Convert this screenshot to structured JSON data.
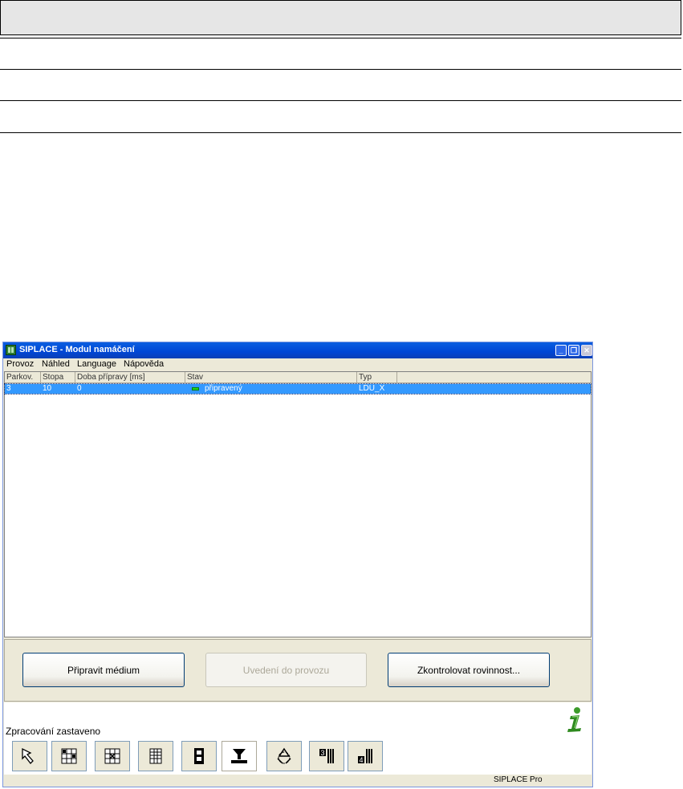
{
  "window": {
    "title": "SIPLACE - Modul namáčení",
    "min_glyph": "_",
    "max_glyph": "❐",
    "close_glyph": "✕"
  },
  "menu": [
    "Provoz",
    "Náhled",
    "Language",
    "Nápověda"
  ],
  "table": {
    "columns": [
      "Parkov.",
      "Stopa",
      "Doba přípravy [ms]",
      "Stav",
      "Typ"
    ],
    "rows": [
      {
        "parkov": "3",
        "stopa": "10",
        "doba": "0",
        "stav": "připravený",
        "typ": "LDU_X"
      }
    ]
  },
  "actions": {
    "prepare": "Připravit médium",
    "commission": "Uvedení do provozu",
    "check": "Zkontrolovat rovinnost..."
  },
  "status": {
    "text": "Zpracování zastaveno"
  },
  "toolbar": {
    "icons": [
      "arrow-cursor-icon",
      "grid-icon",
      "grid-cross-icon",
      "table-icon",
      "film-icon",
      "dip-unit-icon",
      "recycle-icon",
      "feeder-3-icon",
      "feeder-4-icon"
    ],
    "active_index": 5
  },
  "footer": {
    "product": "SIPLACE Pro"
  },
  "colors": {
    "titlebar": "#0046d5",
    "selection": "#3399ff",
    "status_ready": "#1fd61f"
  }
}
